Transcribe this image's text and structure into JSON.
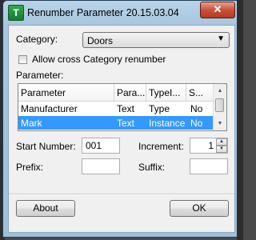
{
  "window": {
    "title": "Renumber Parameter 20.15.03.04",
    "app_icon_text": "T",
    "close_symbol": "✕"
  },
  "form": {
    "category_label": "Category:",
    "category_value": "Doors",
    "checkbox_label": "Allow cross Category renumber",
    "checkbox_checked": false,
    "parameter_label": "Parameter:"
  },
  "table": {
    "columns": [
      "Parameter",
      "Para...",
      "TypeI...",
      "S..."
    ],
    "rows": [
      {
        "parameter": "Manufacturer",
        "param_type": "Text",
        "type_instance": "Type",
        "shared": "No",
        "selected": false
      },
      {
        "parameter": "Mark",
        "param_type": "Text",
        "type_instance": "Instance",
        "shared": "No",
        "selected": true
      }
    ]
  },
  "fields": {
    "start_number_label": "Start Number:",
    "start_number_value": "001",
    "increment_label": "Increment:",
    "increment_value": "1",
    "prefix_label": "Prefix:",
    "prefix_value": "",
    "suffix_label": "Suffix:",
    "suffix_value": ""
  },
  "buttons": {
    "about": "About",
    "ok": "OK"
  },
  "colors": {
    "selection": "#3399ff",
    "titlebar": "#a7c6df",
    "close": "#c7513a"
  }
}
